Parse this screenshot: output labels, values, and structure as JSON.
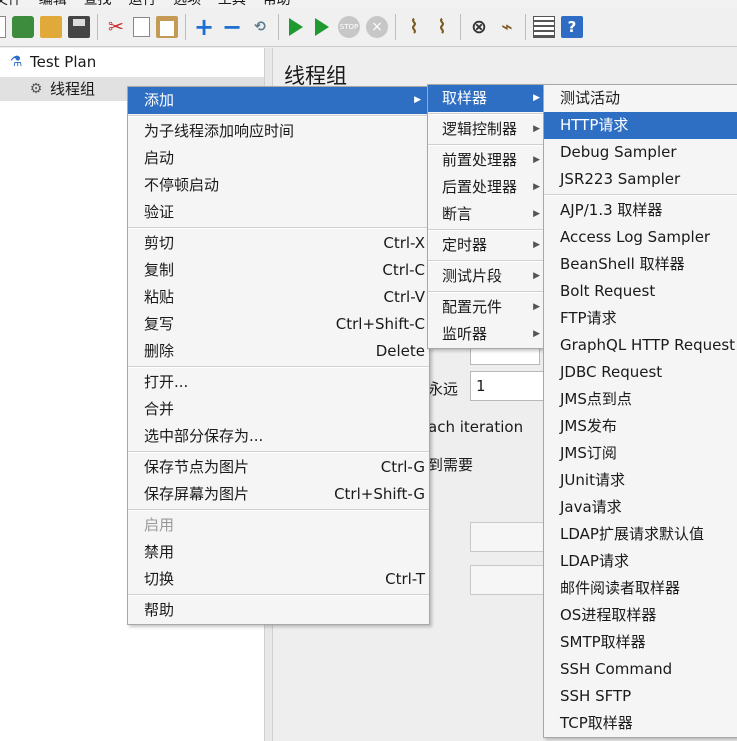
{
  "menubar": [
    "文件",
    "编辑",
    "查找",
    "运行",
    "选项",
    "工具",
    "帮助"
  ],
  "toolbar": {
    "icons": [
      "new-icon",
      "template-icon",
      "open-icon",
      "save-icon",
      "cut-icon",
      "copy-icon",
      "paste-icon",
      "add-icon",
      "remove-icon",
      "toggle-icon",
      "start-icon",
      "start-no-pause-icon",
      "stop-icon",
      "shutdown-icon",
      "clear-icon",
      "clear-all-icon",
      "search-icon",
      "reset-search-icon",
      "function-helper-icon",
      "help-icon"
    ],
    "stop_label": "STOP"
  },
  "tree": {
    "items": [
      {
        "label": "Test Plan",
        "icon": "flask-icon"
      },
      {
        "label": "线程组",
        "icon": "gear-icon"
      }
    ]
  },
  "panel": {
    "title": "线程组",
    "loop_suffix": "永远",
    "loop_value": "1",
    "each_iteration_text": "ach iteration",
    "delay_text": "到需要"
  },
  "context_menu": {
    "groups": [
      [
        {
          "label": "添加",
          "submenu": true,
          "highlight": true
        }
      ],
      [
        {
          "label": "为子线程添加响应时间"
        },
        {
          "label": "启动"
        },
        {
          "label": "不停顿启动"
        },
        {
          "label": "验证"
        }
      ],
      [
        {
          "label": "剪切",
          "shortcut": "Ctrl-X"
        },
        {
          "label": "复制",
          "shortcut": "Ctrl-C"
        },
        {
          "label": "粘贴",
          "shortcut": "Ctrl-V"
        },
        {
          "label": "复写",
          "shortcut": "Ctrl+Shift-C"
        },
        {
          "label": "删除",
          "shortcut": "Delete"
        }
      ],
      [
        {
          "label": "打开..."
        },
        {
          "label": "合并"
        },
        {
          "label": "选中部分保存为..."
        }
      ],
      [
        {
          "label": "保存节点为图片",
          "shortcut": "Ctrl-G"
        },
        {
          "label": "保存屏幕为图片",
          "shortcut": "Ctrl+Shift-G"
        }
      ],
      [
        {
          "label": "启用",
          "disabled": true
        },
        {
          "label": "禁用"
        },
        {
          "label": "切换",
          "shortcut": "Ctrl-T"
        }
      ],
      [
        {
          "label": "帮助"
        }
      ]
    ]
  },
  "add_submenu": {
    "groups": [
      [
        {
          "label": "取样器",
          "highlight": true
        }
      ],
      [
        {
          "label": "逻辑控制器"
        }
      ],
      [
        {
          "label": "前置处理器"
        },
        {
          "label": "后置处理器"
        },
        {
          "label": "断言"
        }
      ],
      [
        {
          "label": "定时器"
        }
      ],
      [
        {
          "label": "测试片段"
        }
      ],
      [
        {
          "label": "配置元件"
        },
        {
          "label": "监听器"
        }
      ]
    ]
  },
  "sampler_submenu": {
    "groups": [
      [
        {
          "label": "测试活动"
        },
        {
          "label": "HTTP请求",
          "highlight": true
        },
        {
          "label": "Debug Sampler"
        },
        {
          "label": "JSR223 Sampler"
        }
      ],
      [
        {
          "label": "AJP/1.3 取样器"
        },
        {
          "label": "Access Log Sampler"
        },
        {
          "label": "BeanShell 取样器"
        },
        {
          "label": "Bolt Request"
        },
        {
          "label": "FTP请求"
        },
        {
          "label": "GraphQL HTTP Request"
        },
        {
          "label": "JDBC Request"
        },
        {
          "label": "JMS点到点"
        },
        {
          "label": "JMS发布"
        },
        {
          "label": "JMS订阅"
        },
        {
          "label": "JUnit请求"
        },
        {
          "label": "Java请求"
        },
        {
          "label": "LDAP扩展请求默认值"
        },
        {
          "label": "LDAP请求"
        },
        {
          "label": "邮件阅读者取样器"
        },
        {
          "label": "OS进程取样器"
        },
        {
          "label": "SMTP取样器"
        },
        {
          "label": "SSH Command"
        },
        {
          "label": "SSH SFTP"
        },
        {
          "label": "TCP取样器"
        }
      ]
    ]
  },
  "colors": {
    "highlight": "#2f6fc3",
    "menu_bg": "#f5f5f5",
    "run_green": "#1e9a2e"
  }
}
